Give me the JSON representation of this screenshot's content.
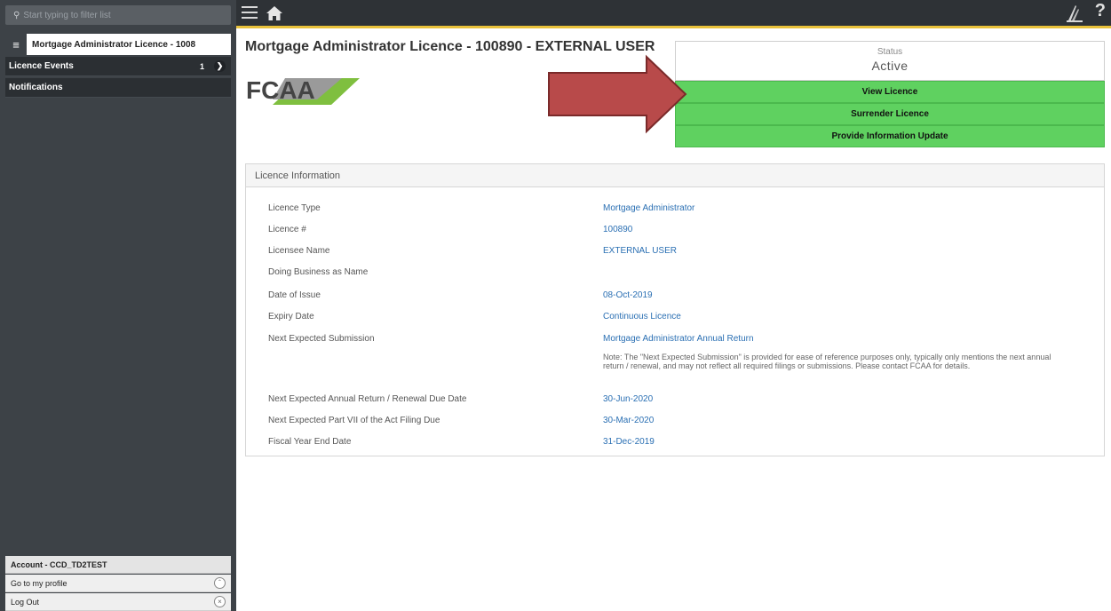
{
  "sidebar": {
    "search_placeholder": "Start typing to filter list",
    "entity_title": "Mortgage Administrator Licence - 1008",
    "nav": {
      "licence_events": "Licence Events",
      "licence_events_count": "1",
      "notifications": "Notifications"
    },
    "account": {
      "title": "Account - CCD_TD2TEST",
      "profile": "Go to my profile",
      "logout": "Log Out"
    }
  },
  "topbar": {
    "help": "?"
  },
  "main": {
    "title": "Mortgage Administrator Licence - 100890 - EXTERNAL USER",
    "logo_text": "FCAA",
    "status": {
      "label": "Status",
      "value": "Active"
    },
    "actions": {
      "view": "View Licence",
      "surrender": "Surrender Licence",
      "update": "Provide Information Update"
    },
    "panel_title": "Licence Information",
    "info": {
      "licence_type": {
        "label": "Licence Type",
        "value": "Mortgage Administrator"
      },
      "licence_number": {
        "label": "Licence #",
        "value": "100890"
      },
      "licensee_name": {
        "label": "Licensee Name",
        "value": "EXTERNAL USER"
      },
      "dba_name": {
        "label": "Doing Business as Name",
        "value": ""
      },
      "date_of_issue": {
        "label": "Date of Issue",
        "value": "08-Oct-2019"
      },
      "expiry_date": {
        "label": "Expiry Date",
        "value": "Continuous Licence"
      },
      "next_submission": {
        "label": "Next Expected Submission",
        "value": "Mortgage Administrator Annual Return"
      },
      "note": "Note: The \"Next Expected Submission\" is provided for ease of reference purposes only, typically only mentions the next annual return / renewal, and may not reflect all required filings or submissions. Please contact FCAA for details.",
      "annual_return_due": {
        "label": "Next Expected Annual Return / Renewal Due Date",
        "value": "30-Jun-2020"
      },
      "part_vii_due": {
        "label": "Next Expected Part VII of the Act Filing Due",
        "value": "30-Mar-2020"
      },
      "fiscal_year_end": {
        "label": "Fiscal Year End Date",
        "value": "31-Dec-2019"
      }
    }
  },
  "colors": {
    "sidebar_bg": "#3d4247",
    "topbar_bg": "#2e3236",
    "topbar_accent": "#e8c13a",
    "action_green": "#5fd160",
    "arrow_red": "#b84a4a",
    "link_blue": "#2a6fb3"
  }
}
